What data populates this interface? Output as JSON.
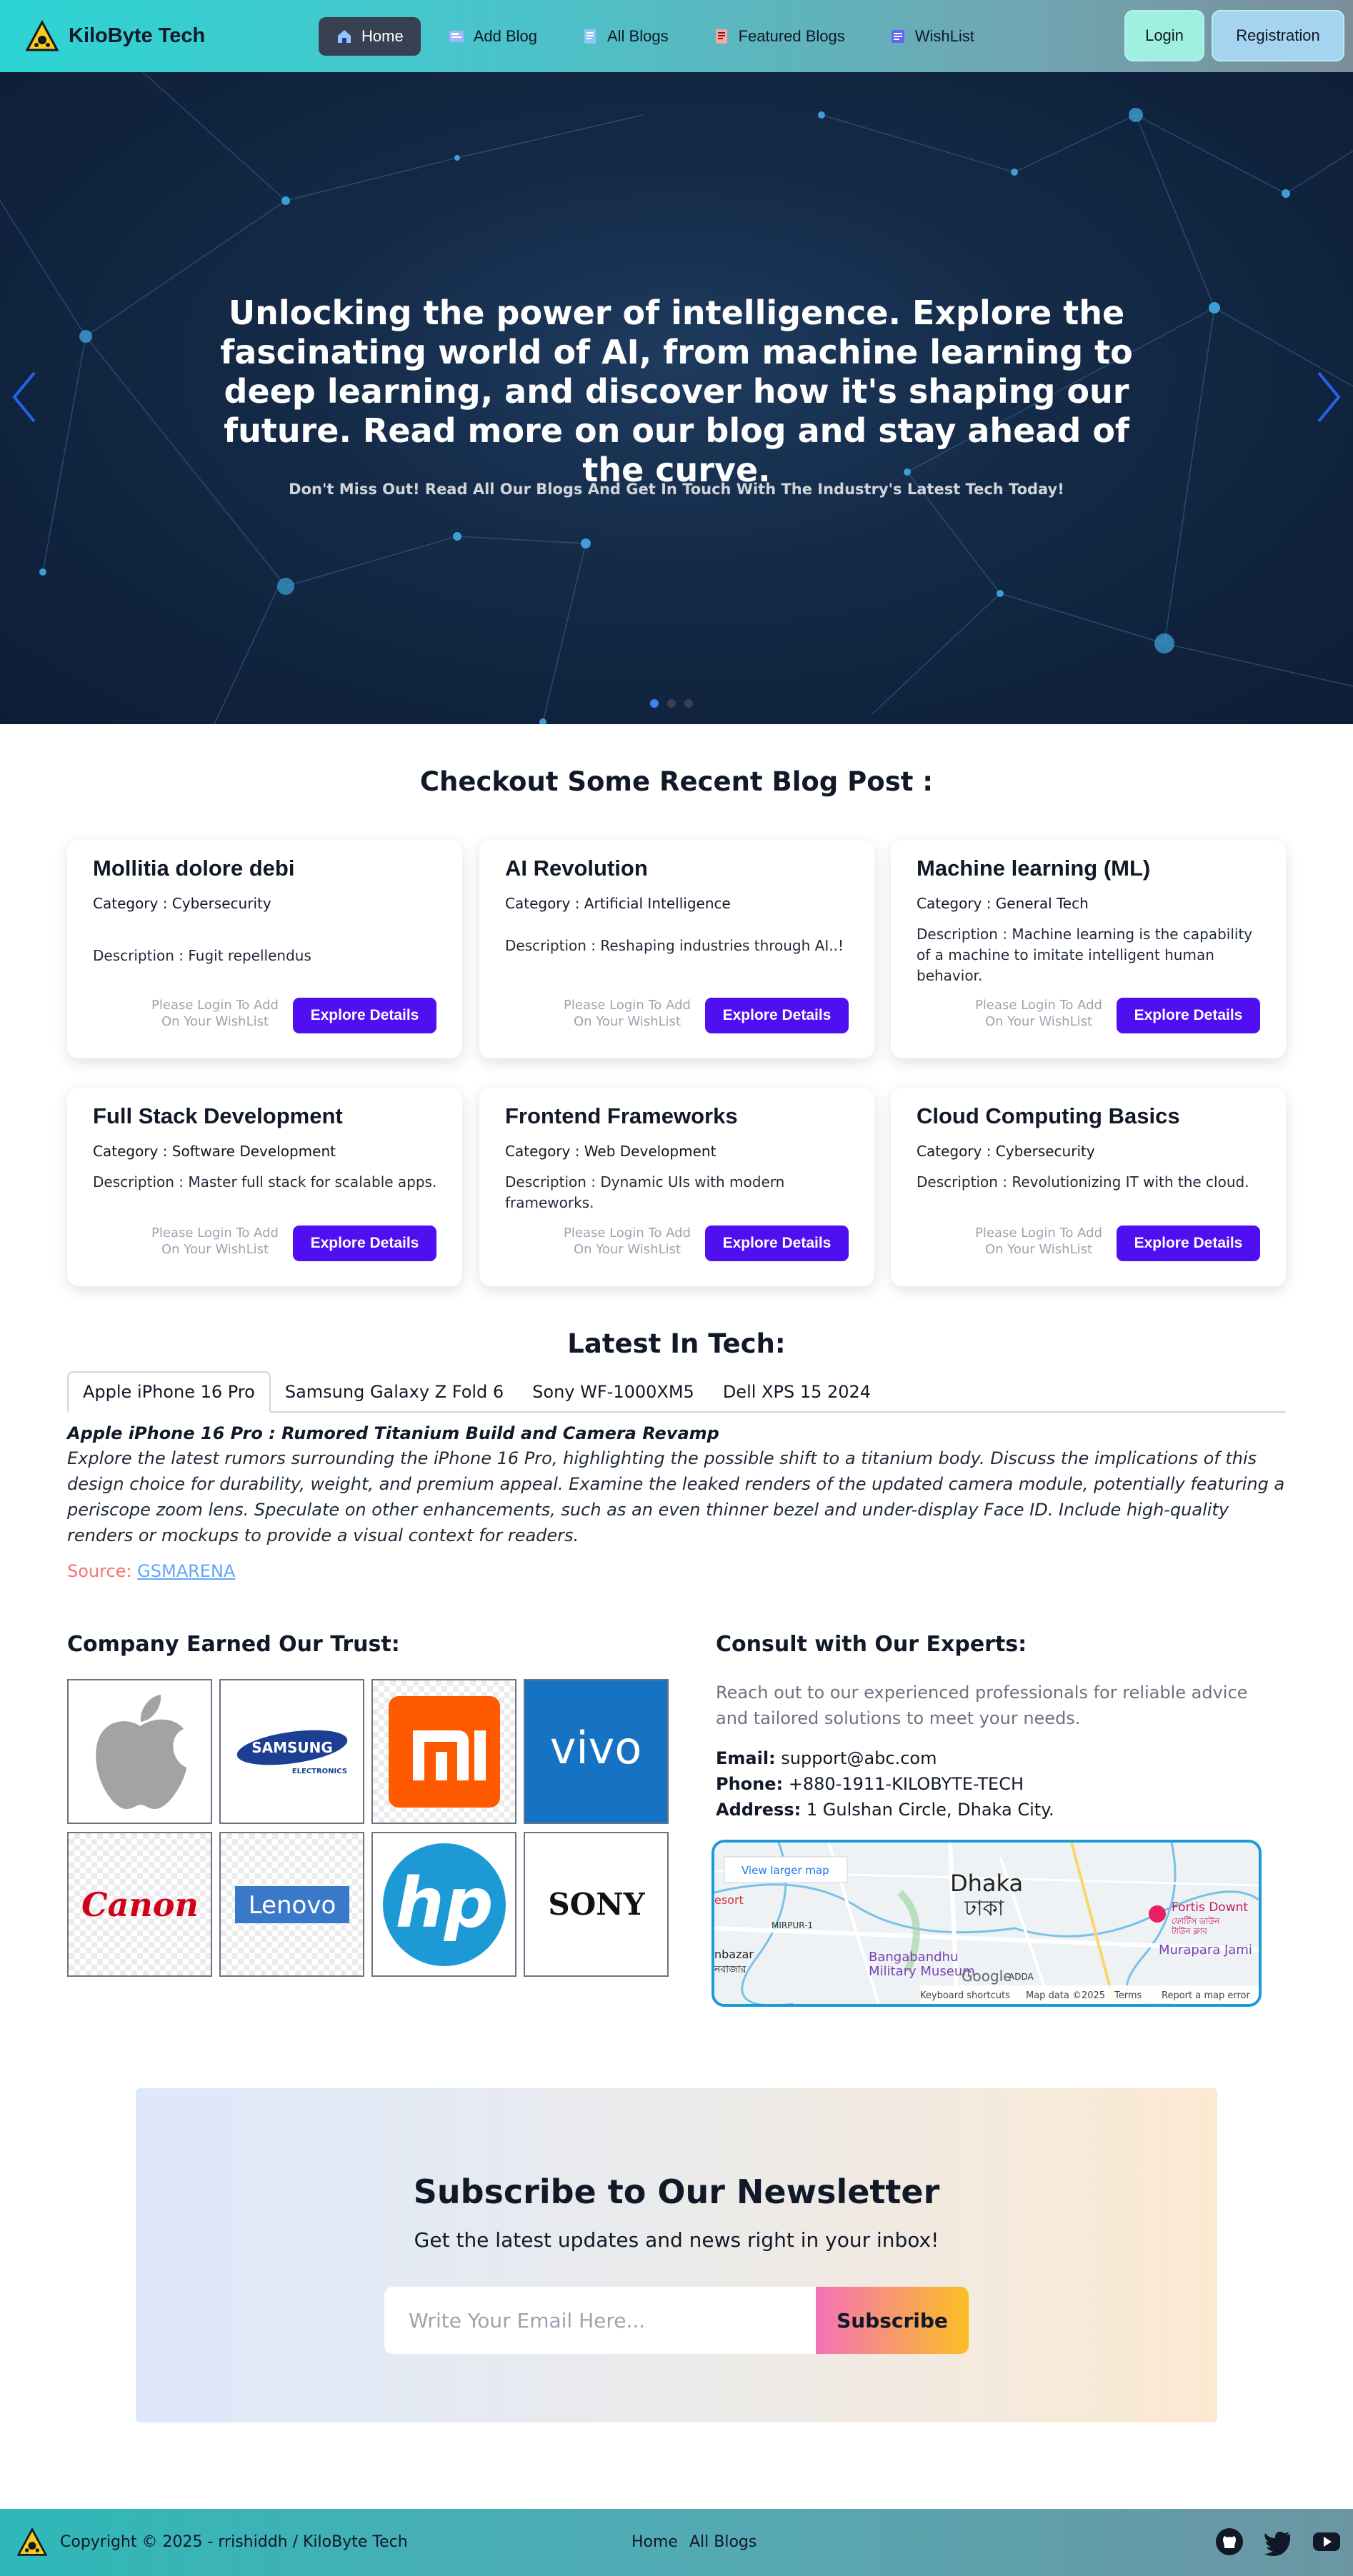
{
  "brand": {
    "name": "KiloByte Tech"
  },
  "nav": {
    "links": [
      {
        "label": "Home",
        "icon": "home-icon",
        "active": true
      },
      {
        "label": "Add Blog",
        "icon": "add-blog-icon"
      },
      {
        "label": "All Blogs",
        "icon": "blogs-icon"
      },
      {
        "label": "Featured Blogs",
        "icon": "featured-icon"
      },
      {
        "label": "WishList",
        "icon": "wishlist-icon"
      }
    ],
    "login": "Login",
    "registration": "Registration"
  },
  "hero": {
    "title": "Unlocking the power of intelligence. Explore the fascinating world of AI, from machine learning to deep learning, and discover how it's shaping our future. Read more on our blog and stay ahead of the curve.",
    "subtitle": "Don't Miss Out! Read All Our Blogs And Get In Touch With The Industry's Latest Tech Today!"
  },
  "recent": {
    "title": "Checkout Some Recent Blog Post :",
    "login_note": "Please Login To Add On Your WishList",
    "explore_label": "Explore Details",
    "cards": [
      {
        "title": "Mollitia dolore debi",
        "category": "Category : Cybersecurity",
        "description": "Description : Fugit repellendus"
      },
      {
        "title": "AI Revolution",
        "category": "Category : Artificial Intelligence",
        "description": "Description : Reshaping industries through AI..!"
      },
      {
        "title": "Machine learning (ML)",
        "category": "Category : General Tech",
        "description": "Description : Machine learning is the capability of a machine to imitate intelligent human behavior."
      },
      {
        "title": "Full Stack Development",
        "category": "Category : Software Development",
        "description": "Description : Master full stack for scalable apps."
      },
      {
        "title": "Frontend Frameworks",
        "category": "Category : Web Development",
        "description": "Description : Dynamic UIs with modern frameworks."
      },
      {
        "title": "Cloud Computing Basics",
        "category": "Category : Cybersecurity",
        "description": "Description : Revolutionizing IT with the cloud."
      }
    ]
  },
  "latest": {
    "title": "Latest In Tech:",
    "tabs": [
      "Apple iPhone 16 Pro",
      "Samsung Galaxy Z Fold 6",
      "Sony WF-1000XM5",
      "Dell XPS 15 2024"
    ],
    "active_heading": "Apple iPhone 16 Pro : Rumored Titanium Build and Camera Revamp",
    "active_body": "Explore the latest rumors surrounding the iPhone 16 Pro, highlighting the possible shift to a titanium body. Discuss the implications of this design choice for durability, weight, and premium appeal. Examine the leaked renders of the updated camera module, potentially featuring a periscope zoom lens. Speculate on other enhancements, such as an even thinner bezel and under-display Face ID. Include high-quality renders or mockups to provide a visual context for readers.",
    "source_label": "Source:",
    "source_link": "GSMARENA"
  },
  "trust": {
    "title": "Company Earned Our Trust:",
    "logos": [
      "Apple",
      "SAMSUNG",
      "mi",
      "vivo",
      "Canon",
      "Lenovo",
      "hp",
      "SONY"
    ],
    "samsung_sub": "ELECTRONICS"
  },
  "consult": {
    "title": "Consult with Our Experts:",
    "description": "Reach out to our experienced professionals for reliable advice and tailored solutions to meet your needs.",
    "email_label": "Email:",
    "email": "support@abc.com",
    "phone_label": "Phone:",
    "phone": "+880-1911-KILOBYTE-TECH",
    "address_label": "Address:",
    "address": "1 Gulshan Circle, Dhaka City.",
    "map": {
      "view_larger": "View larger map",
      "city": "Dhaka",
      "city_local": "ঢাকা",
      "labels": [
        "esort",
        "MIRPUR-1",
        "nbazar",
        "নবাজার",
        "Bangabandhu",
        "Military Museum",
        "Fortis Downt",
        "ফোর্টিস ডাউন",
        "টাউন ক্লাব",
        "Murapara Jami",
        "ADDA",
        "Google"
      ],
      "footer": [
        "Keyboard shortcuts",
        "Map data ©2025",
        "Terms",
        "Report a map error"
      ]
    }
  },
  "newsletter": {
    "title": "Subscribe to Our Newsletter",
    "subtitle": "Get the latest updates and news right in your inbox!",
    "placeholder": "Write Your Email Here...",
    "button": "Subscribe"
  },
  "footer": {
    "copyright": "Copyright © 2025 - rrishiddh / KiloByte Tech",
    "links": [
      "Home",
      "All Blogs"
    ],
    "social": [
      "github-icon",
      "twitter-icon",
      "youtube-icon"
    ]
  },
  "colors": {
    "accent": "#4f0ff0",
    "hero_bg": "#142a47",
    "nav_active": "#374151"
  }
}
